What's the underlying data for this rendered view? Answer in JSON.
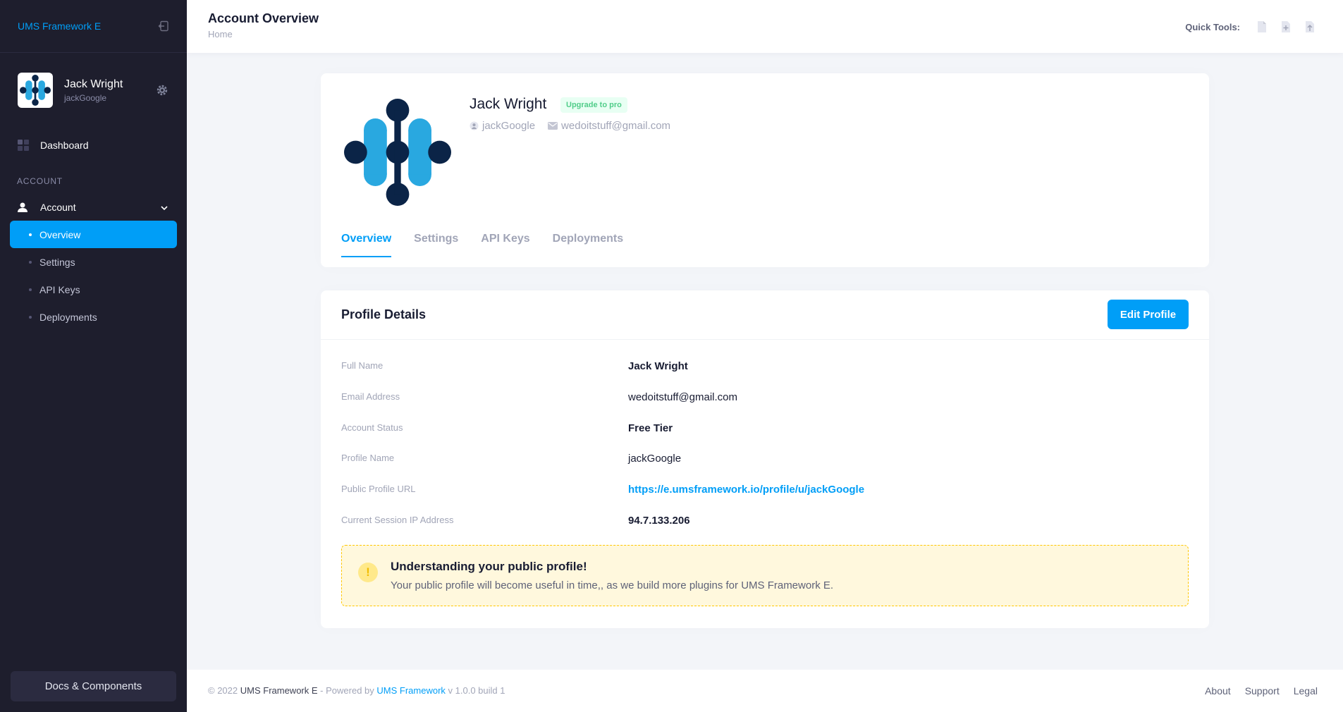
{
  "sidebar": {
    "brand": "UMS Framework E",
    "user": {
      "name": "Jack Wright",
      "handle": "jackGoogle"
    },
    "dashboard_label": "Dashboard",
    "section_label": "ACCOUNT",
    "account_label": "Account",
    "subitems": [
      {
        "label": "Overview",
        "active": true
      },
      {
        "label": "Settings",
        "active": false
      },
      {
        "label": "API Keys",
        "active": false
      },
      {
        "label": "Deployments",
        "active": false
      }
    ],
    "docs_label": "Docs & Components"
  },
  "header": {
    "title": "Account Overview",
    "breadcrumb": "Home",
    "quick_tools_label": "Quick Tools:"
  },
  "profile": {
    "name": "Jack Wright",
    "badge": "Upgrade to pro",
    "handle": "jackGoogle",
    "email": "wedoitstuff@gmail.com",
    "tabs": [
      "Overview",
      "Settings",
      "API Keys",
      "Deployments"
    ]
  },
  "details": {
    "title": "Profile Details",
    "edit_label": "Edit Profile",
    "rows": [
      {
        "label": "Full Name",
        "value": "Jack Wright"
      },
      {
        "label": "Email Address",
        "value": "wedoitstuff@gmail.com"
      },
      {
        "label": "Account Status",
        "value": "Free Tier"
      },
      {
        "label": "Profile Name",
        "value": "jackGoogle"
      },
      {
        "label": "Public Profile URL",
        "value": "https://e.umsframework.io/profile/u/jackGoogle"
      },
      {
        "label": "Current Session IP Address",
        "value": "94.7.133.206"
      }
    ],
    "notice": {
      "icon": "!",
      "title": "Understanding your public profile!",
      "text": "Your public profile will become useful in time,, as we build more plugins for UMS Framework E."
    }
  },
  "footer": {
    "copyright": "© 2022",
    "product": "UMS Framework E",
    "powered_by": "- Powered by",
    "framework_link": "UMS Framework",
    "version": "v 1.0.0 build 1",
    "links": [
      "About",
      "Support",
      "Legal"
    ]
  },
  "colors": {
    "accent": "#009ef7",
    "sidebar_bg": "#1e1e2d",
    "success": "#50cd89",
    "warning_bg": "#fff8dd"
  }
}
